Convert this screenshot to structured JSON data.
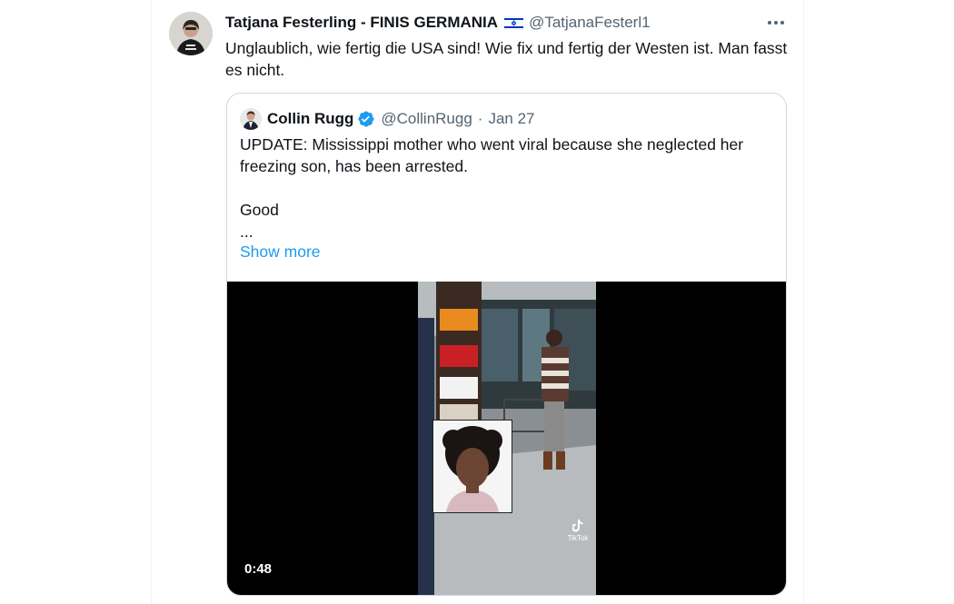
{
  "tweet": {
    "author_name": "Tatjana Festerling - FINIS GERMANIA",
    "author_flag_icon": "israel-flag-icon",
    "author_handle": "@TatjanaFesterl1",
    "text": "Unglaublich, wie fertig die USA sind! Wie fix und fertig der Westen ist. Man fasst es nicht.",
    "more_icon": "ellipsis-icon"
  },
  "quote": {
    "author_name": "Collin Rugg",
    "verified_icon": "verified-badge-icon",
    "author_handle": "@CollinRugg",
    "separator": "·",
    "date": "Jan 27",
    "text_line1": "UPDATE: Mississippi mother who went viral because she neglected her freezing son, has been arrested.",
    "text_line2": "Good",
    "text_line3": "...",
    "show_more": "Show more",
    "video": {
      "duration": "0:48",
      "watermark": "TikTok",
      "brand_color": "#1d9bf0"
    }
  }
}
